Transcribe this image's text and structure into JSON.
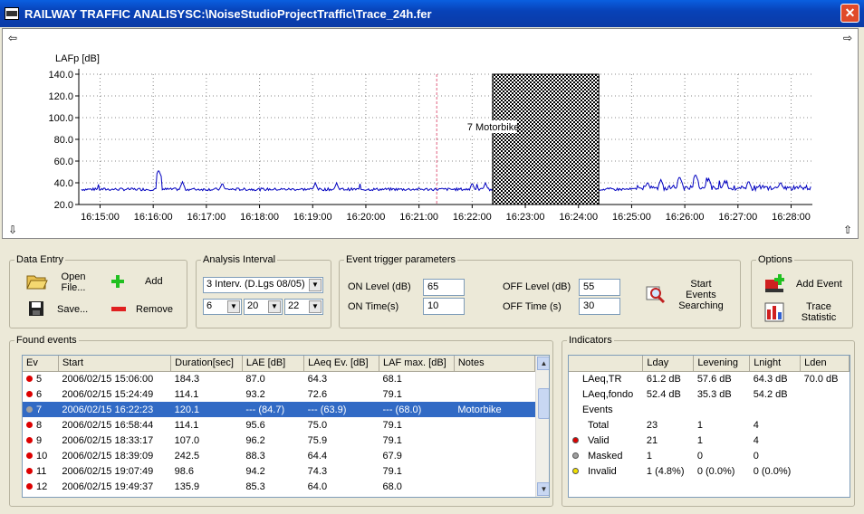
{
  "window": {
    "title": "RAILWAY TRAFFIC ANALISYSC:\\NoiseStudioProjectTraffic\\Trace_24h.fer"
  },
  "chart_data": {
    "type": "line",
    "ylabel": "LAFp [dB]",
    "ylim": [
      20,
      140
    ],
    "yticks": [
      "140.0",
      "120.0",
      "100.0",
      "80.0",
      "60.0",
      "40.0",
      "20.0"
    ],
    "xticks": [
      "16:15:00",
      "16:16:00",
      "16:17:00",
      "16:18:00",
      "16:19:00",
      "16:20:00",
      "16:21:00",
      "16:22:00",
      "16:23:00",
      "16:24:00",
      "16:25:00",
      "16:26:00",
      "16:27:00",
      "16:28:00"
    ],
    "series": [
      {
        "baseline_db": 34,
        "peaks": [
          [
            16.1,
            52
          ],
          [
            16.55,
            41
          ],
          [
            17.3,
            40
          ],
          [
            19.05,
            40
          ],
          [
            19.45,
            40
          ],
          [
            22.0,
            40
          ],
          [
            22.25,
            40
          ],
          [
            25.3,
            41
          ],
          [
            25.55,
            43
          ],
          [
            25.9,
            46
          ],
          [
            26.2,
            48
          ],
          [
            26.45,
            44
          ],
          [
            26.75,
            42
          ],
          [
            27.2,
            42
          ],
          [
            27.8,
            41
          ]
        ]
      }
    ],
    "highlight_event": {
      "label": "7 Motorbike",
      "start_time": "16:22:23",
      "end_time": "16:24:23",
      "top_db": 140,
      "bottom_db": 20
    },
    "cursor_time": "16:21:20",
    "grid": true
  },
  "data_entry": {
    "title": "Data Entry",
    "open_label": "Open\nFile...",
    "save_label": "Save...",
    "add_label": "Add",
    "remove_label": "Remove"
  },
  "analysis_interval": {
    "title": "Analysis Interval",
    "mode": "3 Interv. (D.Lgs 08/05)",
    "h1": "6",
    "h2": "20",
    "h3": "22"
  },
  "trigger": {
    "title": "Event trigger parameters",
    "on_level_label": "ON Level (dB)",
    "on_level": "65",
    "on_time_label": "ON Time(s)",
    "on_time": "10",
    "off_level_label": "OFF Level (dB)",
    "off_level": "55",
    "off_time_label": "OFF Time (s)",
    "off_time": "30",
    "search_label": "Start\nEvents\nSearching"
  },
  "options": {
    "title": "Options",
    "add_event_label": "Add Event",
    "trace_stat_label": "Trace\nStatistic"
  },
  "found_events": {
    "title": "Found events",
    "columns": [
      "Ev",
      "Start",
      "Duration[sec]",
      "LAE [dB]",
      "LAeq Ev. [dB]",
      "LAF max. [dB]",
      "Notes"
    ],
    "rows": [
      {
        "ev": "5",
        "start": "2006/02/15 15:06:00",
        "dur": "184.3",
        "lae": "87.0",
        "laeq": "64.3",
        "lafmax": "68.1",
        "notes": "",
        "color": "#dd0000"
      },
      {
        "ev": "6",
        "start": "2006/02/15 15:24:49",
        "dur": "114.1",
        "lae": "93.2",
        "laeq": "72.6",
        "lafmax": "79.1",
        "notes": "",
        "color": "#dd0000"
      },
      {
        "ev": "7",
        "start": "2006/02/15 16:22:23",
        "dur": "120.1",
        "lae": "--- (84.7)",
        "laeq": "--- (63.9)",
        "lafmax": "--- (68.0)",
        "notes": "Motorbike",
        "color": "#a0a0a0"
      },
      {
        "ev": "8",
        "start": "2006/02/15 16:58:44",
        "dur": "114.1",
        "lae": "95.6",
        "laeq": "75.0",
        "lafmax": "79.1",
        "notes": "",
        "color": "#dd0000"
      },
      {
        "ev": "9",
        "start": "2006/02/15 18:33:17",
        "dur": "107.0",
        "lae": "96.2",
        "laeq": "75.9",
        "lafmax": "79.1",
        "notes": "",
        "color": "#dd0000"
      },
      {
        "ev": "10",
        "start": "2006/02/15 18:39:09",
        "dur": "242.5",
        "lae": "88.3",
        "laeq": "64.4",
        "lafmax": "67.9",
        "notes": "",
        "color": "#dd0000"
      },
      {
        "ev": "11",
        "start": "2006/02/15 19:07:49",
        "dur": "98.6",
        "lae": "94.2",
        "laeq": "74.3",
        "lafmax": "79.1",
        "notes": "",
        "color": "#dd0000"
      },
      {
        "ev": "12",
        "start": "2006/02/15 19:49:37",
        "dur": "135.9",
        "lae": "85.3",
        "laeq": "64.0",
        "lafmax": "68.0",
        "notes": "",
        "color": "#dd0000"
      }
    ],
    "selected_index": 2
  },
  "indicators": {
    "title": "Indicators",
    "columns": [
      "",
      "Lday",
      "Levening",
      "Lnight",
      "Lden"
    ],
    "rows": [
      {
        "label": "LAeq,TR",
        "dot": "",
        "c1": "61.2 dB",
        "c2": "57.6 dB",
        "c3": "64.3 dB",
        "c4": "70.0 dB"
      },
      {
        "label": "LAeq,fondo",
        "dot": "",
        "c1": "52.4 dB",
        "c2": "35.3 dB",
        "c3": "54.2 dB",
        "c4": ""
      },
      {
        "label": "Events",
        "dot": "",
        "c1": "",
        "c2": "",
        "c3": "",
        "c4": ""
      },
      {
        "label": "Total",
        "dot": "",
        "c1": "23",
        "c2": "1",
        "c3": "4",
        "c4": ""
      },
      {
        "label": "Valid",
        "dot": "#dd0000",
        "c1": "21",
        "c2": "1",
        "c3": "4",
        "c4": ""
      },
      {
        "label": "Masked",
        "dot": "#a0a0a0",
        "c1": "1",
        "c2": "0",
        "c3": "0",
        "c4": ""
      },
      {
        "label": "Invalid",
        "dot": "#f0e000",
        "c1": "1 (4.8%)",
        "c2": "0 (0.0%)",
        "c3": "0 (0.0%)",
        "c4": ""
      }
    ]
  }
}
